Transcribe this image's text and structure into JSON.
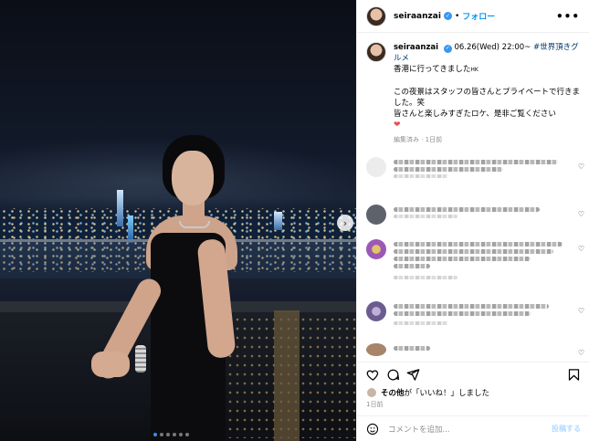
{
  "post": {
    "username": "seiraanzai",
    "follow_label": "フォロー",
    "more_label": "•••",
    "caption": {
      "date_line": "06.26(Wed) 22:00~",
      "hashtag": "#世界頂きグルメ",
      "line2": "香港に行ってきました",
      "line2_flag": "HK",
      "line3": "この夜景はスタッフの皆さんとプライベートで行きました。笑",
      "line4": "皆さんと楽しみすぎたロケ、是非ご覧ください",
      "heart": "❤"
    },
    "edited_meta": "編集済み · 1日前"
  },
  "comments": [
    {
      "id": 1,
      "avatar_color": "#e9e9e9"
    },
    {
      "id": 2,
      "avatar_color": "#6b6f78"
    },
    {
      "id": 3,
      "avatar_color": "#b06fc2"
    },
    {
      "id": 4,
      "avatar_color": "#7a6d9a"
    },
    {
      "id": 5,
      "avatar_color": "#a7846a"
    }
  ],
  "likes": {
    "bold": "その他",
    "rest": "が「いいね！」しました"
  },
  "date_label": "1日前",
  "add_comment": {
    "placeholder": "コメントを追加...",
    "post_label": "投稿する"
  },
  "carousel": {
    "total": 6,
    "active": 1
  },
  "colors": {
    "accent": "#0095f6",
    "verified": "#3897f0",
    "heart": "#ed4956"
  }
}
